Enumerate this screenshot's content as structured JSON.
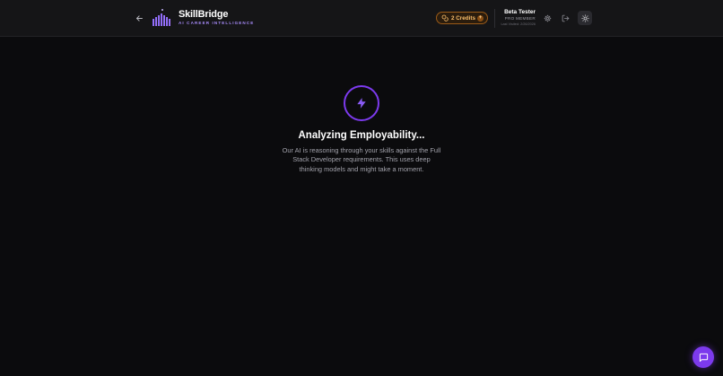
{
  "header": {
    "brand": {
      "name": "SkillBridge",
      "tagline": "AI CAREER INTELLIGENCE",
      "logo_icon": "bar-chart-logo-icon"
    },
    "back_icon": "arrow-left-icon",
    "credits": {
      "label": "2 Credits",
      "icon": "coins-icon",
      "add_symbol": "+"
    },
    "user": {
      "name": "Beta Tester",
      "role": "PRO MEMBER",
      "last_visited": "Last Visited: 2/26/2026"
    },
    "settings_icon": "gear-icon",
    "logout_icon": "logout-icon",
    "theme_icon": "sun-icon"
  },
  "main": {
    "status_icon": "lightning-bolt-icon",
    "title": "Analyzing Employability...",
    "description": "Our AI is reasoning through your skills against the Full Stack Developer requirements. This uses deep thinking models and might take a moment."
  },
  "chat_button": {
    "icon": "chat-bubble-icon"
  },
  "colors": {
    "background": "#0b0b0d",
    "header": "#151517",
    "accent": "#7c3aed",
    "accent_light": "#a78bfa",
    "credits": "#fbbf6a"
  }
}
